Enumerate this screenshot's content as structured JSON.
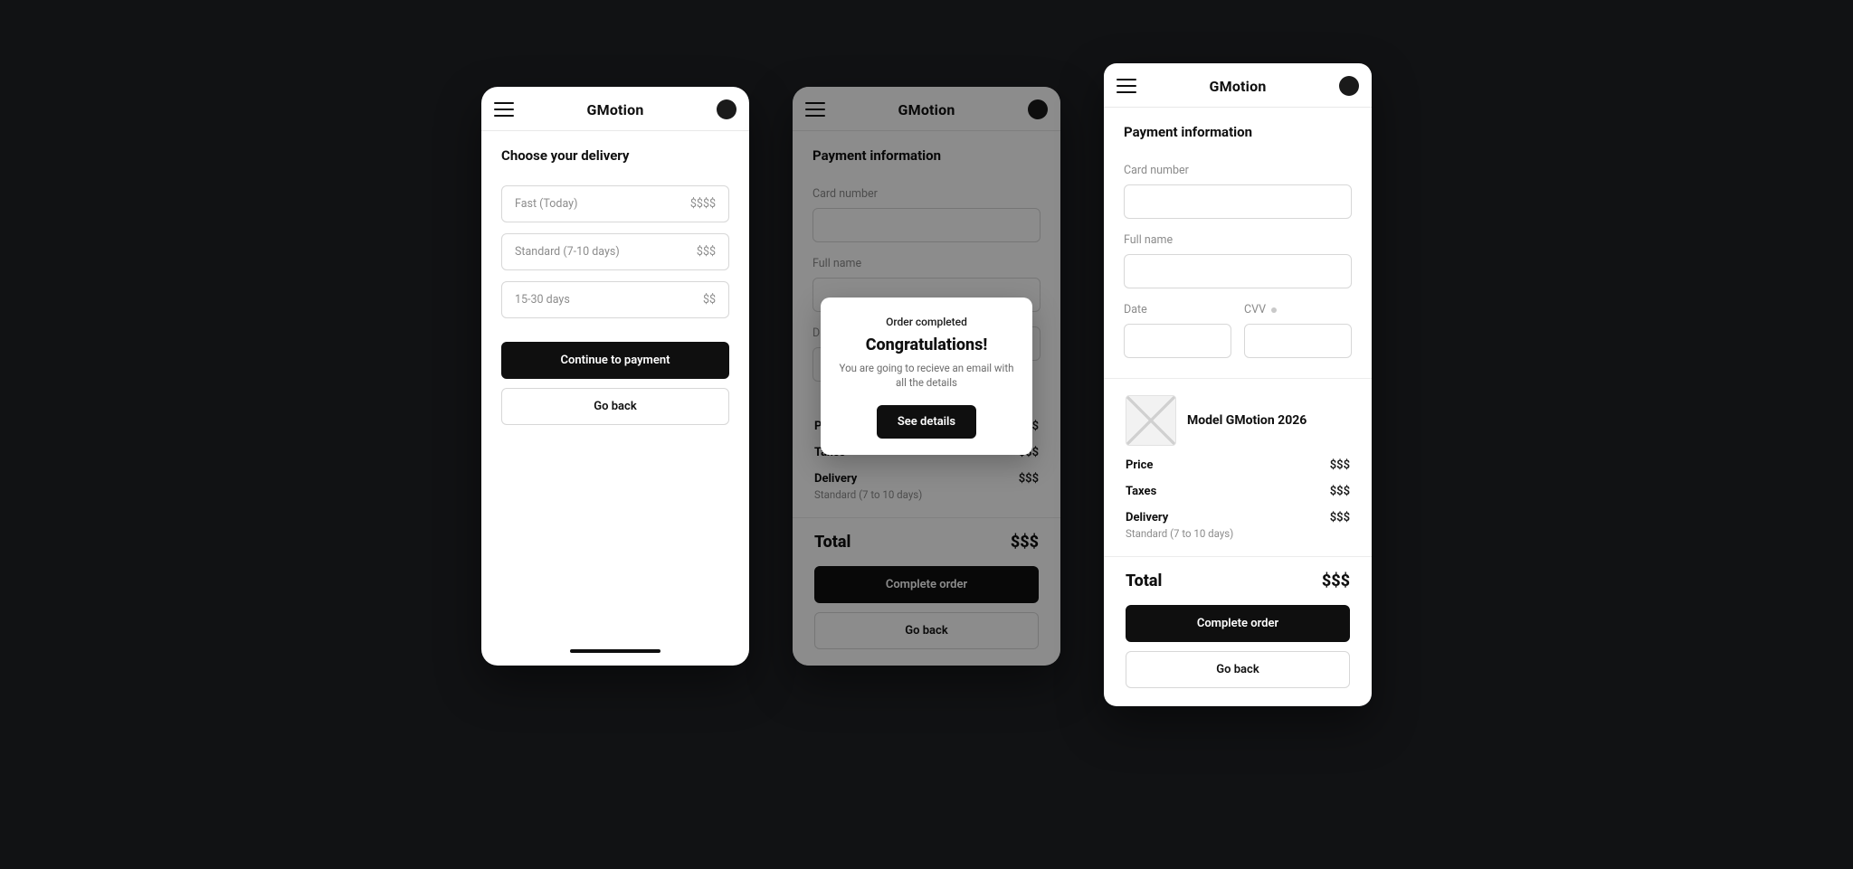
{
  "app": {
    "brand": "GMotion"
  },
  "frameA": {
    "title": "Choose your delivery",
    "options": [
      {
        "label": "Fast (Today)",
        "price": "$$$$"
      },
      {
        "label": "Standard (7-10 days)",
        "price": "$$$"
      },
      {
        "label": "15-30 days",
        "price": "$$"
      }
    ],
    "primary": "Continue to payment",
    "secondary": "Go back"
  },
  "frameB": {
    "title": "Payment information",
    "labels": {
      "card": "Card number",
      "name": "Full name",
      "date": "D",
      "cvv": ""
    },
    "summary": {
      "price_label": "Price",
      "price": "$$$",
      "taxes_label": "Taxes",
      "taxes": "$$$",
      "delivery_label": "Delivery",
      "delivery": "$$$",
      "delivery_note": "Standard (7 to 10 days)",
      "total_label": "Total",
      "total": "$$$"
    },
    "primary": "Complete order",
    "secondary": "Go back",
    "modal": {
      "eyebrow": "Order completed",
      "title": "Congratulations!",
      "body": "You are going to recieve an email with all the details",
      "cta": "See details"
    }
  },
  "frameC": {
    "title": "Payment information",
    "labels": {
      "card": "Card number",
      "name": "Full name",
      "date": "Date",
      "cvv": "CVV"
    },
    "item": {
      "title": "Model GMotion 2026"
    },
    "summary": {
      "price_label": "Price",
      "price": "$$$",
      "taxes_label": "Taxes",
      "taxes": "$$$",
      "delivery_label": "Delivery",
      "delivery": "$$$",
      "delivery_note": "Standard (7 to 10 days)",
      "total_label": "Total",
      "total": "$$$"
    },
    "primary": "Complete order",
    "secondary": "Go back"
  }
}
